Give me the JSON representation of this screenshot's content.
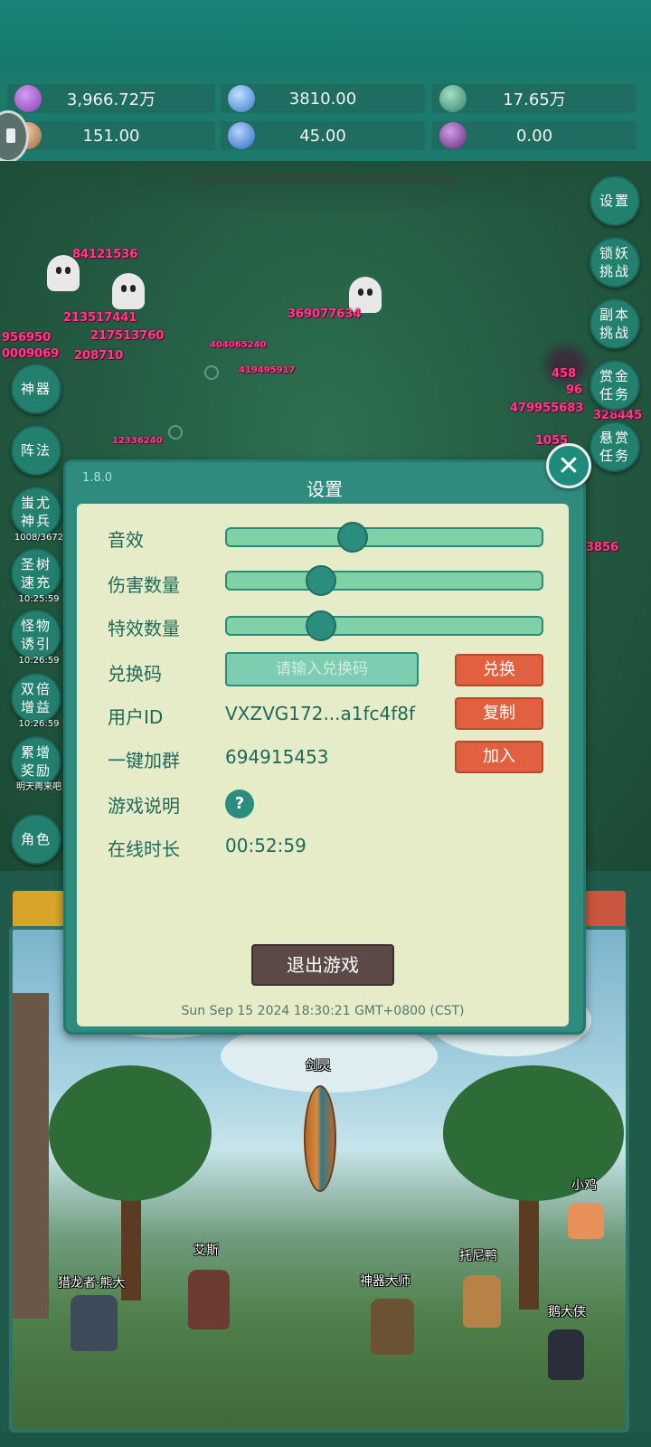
{
  "resources": [
    {
      "icon": "purple-gem-icon",
      "value": "3,966.72万"
    },
    {
      "icon": "blue-crystal-icon",
      "value": "3810.00"
    },
    {
      "icon": "green-orb-icon",
      "value": "17.65万"
    },
    {
      "icon": "horn-icon",
      "value": "151.00"
    },
    {
      "icon": "blue-shard-icon",
      "value": "45.00"
    },
    {
      "icon": "purple-potion-icon",
      "value": "0.00"
    }
  ],
  "left_menu": [
    {
      "label": "神器",
      "sub": ""
    },
    {
      "label": "阵法",
      "sub": ""
    },
    {
      "label": "蚩尤神兵",
      "sub": "1008/3672"
    },
    {
      "label": "圣树速充",
      "sub": "10:25:59"
    },
    {
      "label": "怪物诱引",
      "sub": "10:26:59"
    },
    {
      "label": "双倍增益",
      "sub": "10:26:59"
    },
    {
      "label": "累增奖励",
      "sub": "明天再来吧"
    },
    {
      "label": "角色",
      "sub": ""
    }
  ],
  "right_menu": [
    {
      "label": "设置"
    },
    {
      "label": "锁妖挑战"
    },
    {
      "label": "副本挑战"
    },
    {
      "label": "赏金任务"
    },
    {
      "label": "悬赏任务"
    }
  ],
  "damage_numbers": [
    "84121536",
    "213517441",
    "217513760",
    "369077634",
    "956950",
    "0009069",
    "208710",
    "404065240",
    "419495917",
    "479955683",
    "3856",
    "1055",
    "458",
    "96",
    "328445",
    "12336240"
  ],
  "settings": {
    "version": "1.8.0",
    "title": "设置",
    "sound_label": "音效",
    "sound_level": 0.4,
    "damage_count_label": "伤害数量",
    "damage_count_level": 0.3,
    "effects_count_label": "特效数量",
    "effects_count_level": 0.3,
    "redeem_label": "兑换码",
    "redeem_placeholder": "请输入兑换码",
    "redeem_button": "兑换",
    "user_id_label": "用户ID",
    "user_id_value": "VXZVG172...a1fc4f8f",
    "copy_button": "复制",
    "join_group_label": "一键加群",
    "join_group_value": "694915453",
    "join_button": "加入",
    "game_help_label": "游戏说明",
    "help_icon_text": "?",
    "online_time_label": "在线时长",
    "online_time_value": "00:52:59",
    "quit_button": "退出游戏",
    "timestamp": "Sun Sep 15 2024 18:30:21 GMT+0800 (CST)"
  },
  "heroes": [
    {
      "name": "剑灵"
    },
    {
      "name": "小鸡"
    },
    {
      "name": "艾斯"
    },
    {
      "name": "托尼鸭"
    },
    {
      "name": "猎龙者·熊大"
    },
    {
      "name": "神器大师"
    },
    {
      "name": "鹅大侠"
    }
  ],
  "colors": {
    "accent": "#2e8b7d",
    "panel": "#e6ebc8",
    "action_button": "#e0603f",
    "damage_text": "#ff3c86"
  }
}
